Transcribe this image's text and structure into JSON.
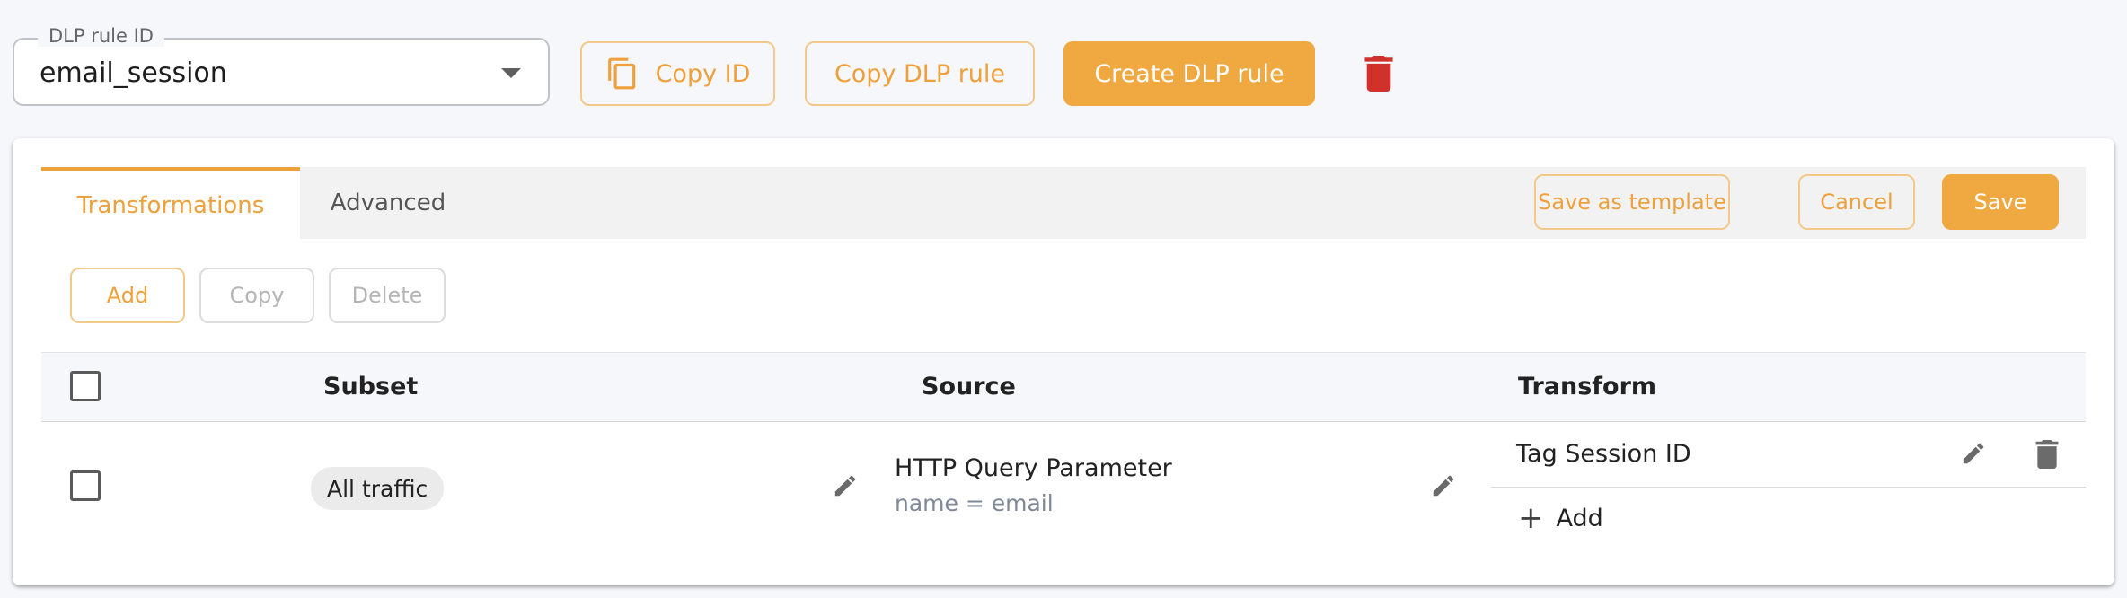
{
  "rule_selector": {
    "label": "DLP rule ID",
    "value": "email_session"
  },
  "top_actions": {
    "copy_id": "Copy ID",
    "copy_rule": "Copy DLP rule",
    "create_rule": "Create DLP rule"
  },
  "tabs": [
    {
      "label": "Transformations",
      "active": true
    },
    {
      "label": "Advanced",
      "active": false
    }
  ],
  "tab_actions": {
    "save_as_template": "Save as template",
    "cancel": "Cancel",
    "save": "Save"
  },
  "list_actions": {
    "add": "Add",
    "copy": "Copy",
    "delete": "Delete"
  },
  "table": {
    "columns": [
      "Subset",
      "Source",
      "Transform"
    ],
    "rows": [
      {
        "checked": false,
        "subset": "All traffic",
        "source": {
          "type": "HTTP Query Parameter",
          "detail": "name = email"
        },
        "transforms": [
          "Tag Session ID"
        ],
        "add_transform_label": "Add"
      }
    ]
  },
  "colors": {
    "accent": "#f0a841",
    "danger": "#d0322b",
    "background": "#f6f7fb"
  },
  "icons": {
    "copy": "copy-icon",
    "trash": "trash-icon",
    "edit": "pencil-icon",
    "add": "plus-icon",
    "dropdown": "chevron-down-icon"
  }
}
